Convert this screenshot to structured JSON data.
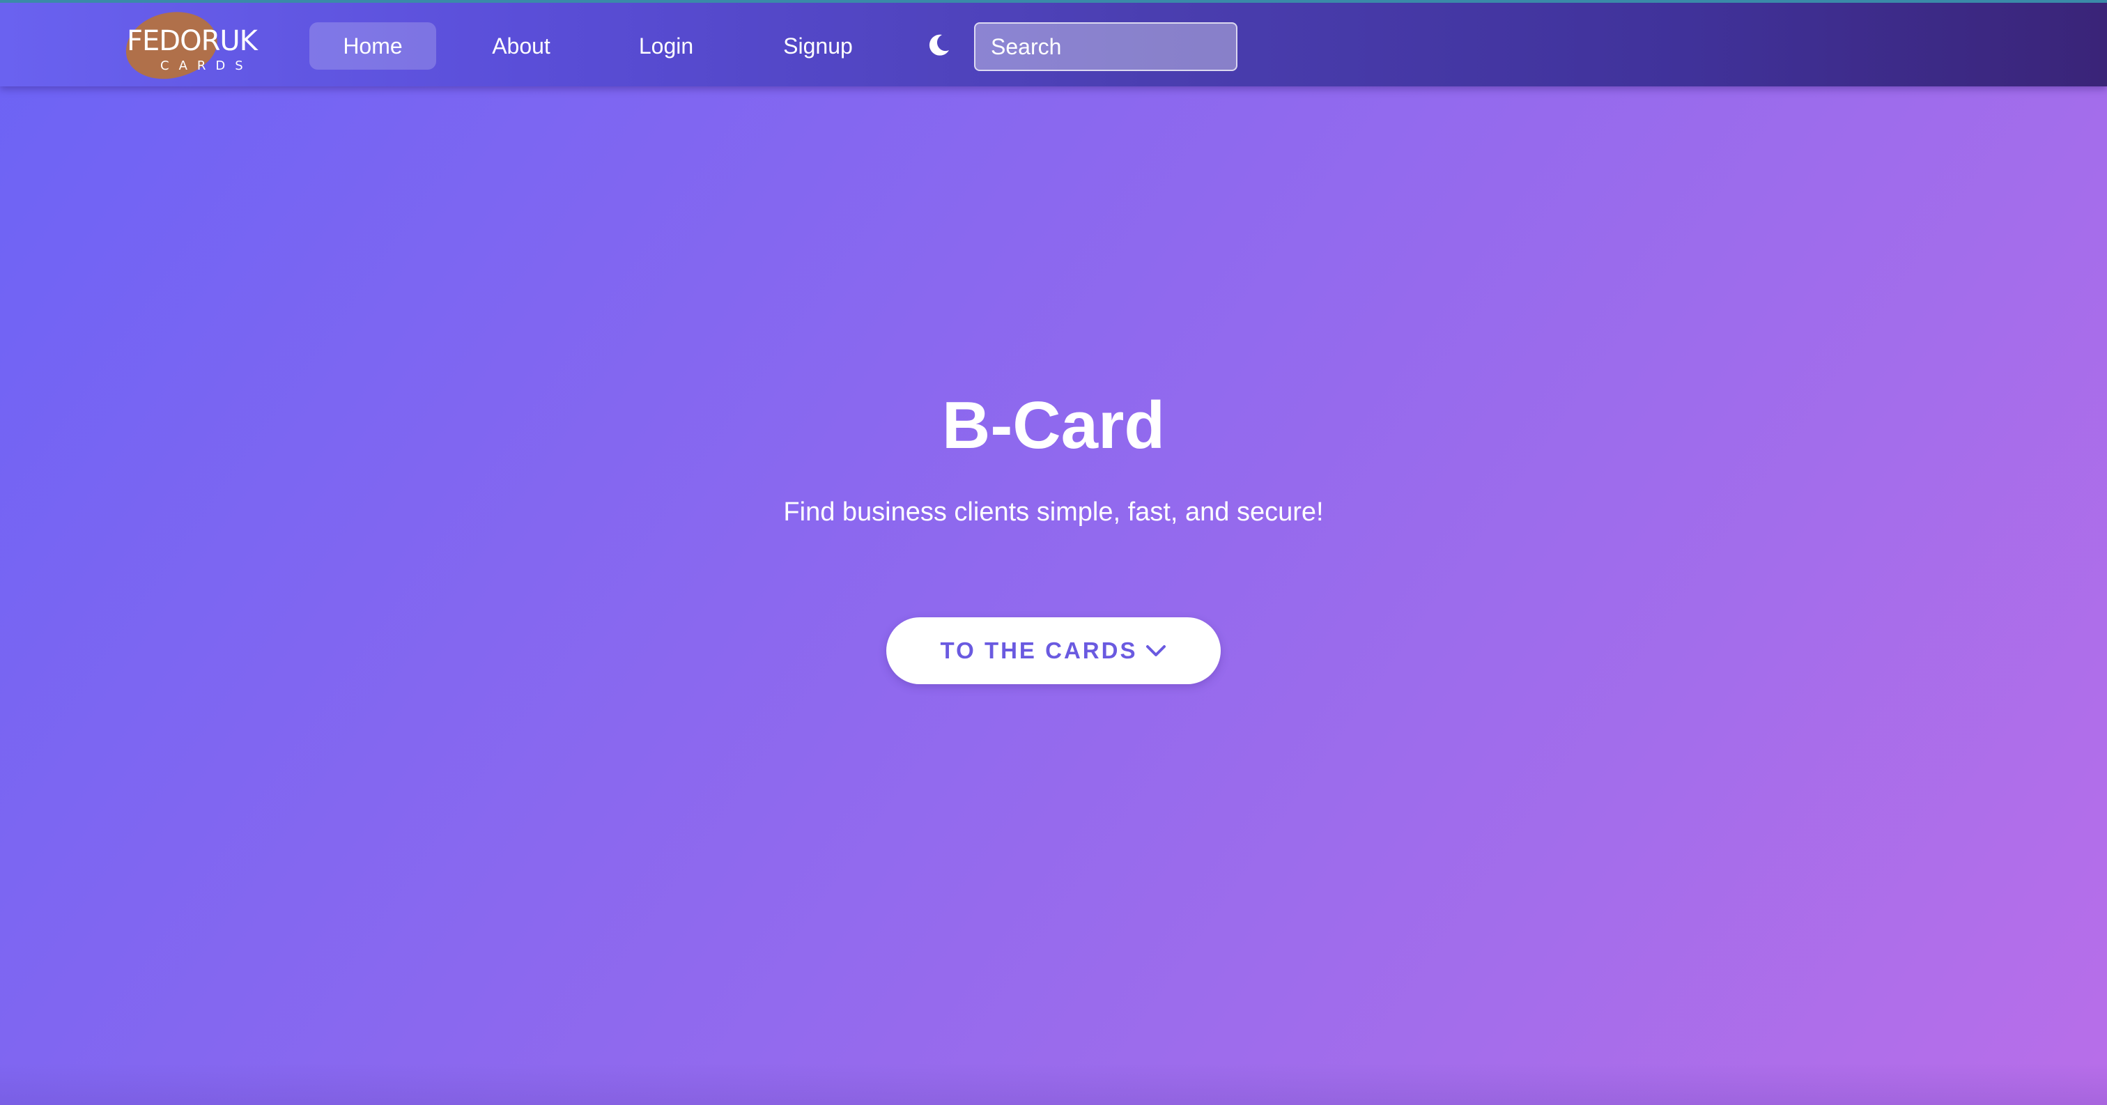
{
  "brand": {
    "logo_text": "FEDORUK",
    "logo_subtext": "CARDS"
  },
  "nav": {
    "items": [
      {
        "label": "Home",
        "active": true
      },
      {
        "label": "About",
        "active": false
      },
      {
        "label": "Login",
        "active": false
      },
      {
        "label": "Signup",
        "active": false
      }
    ],
    "theme_icon": "moon-icon"
  },
  "search": {
    "placeholder": "Search",
    "value": ""
  },
  "hero": {
    "title": "B-Card",
    "subtitle": "Find business clients simple, fast, and secure!",
    "cta_label": "TO THE CARDS",
    "cta_icon": "chevron-down-icon"
  },
  "colors": {
    "gradient_start": "#6c63f5",
    "gradient_end": "#b86ee9",
    "navbar_dark": "#3a2478",
    "accent": "#6a5ae0",
    "logo_blob": "#b0704a"
  }
}
